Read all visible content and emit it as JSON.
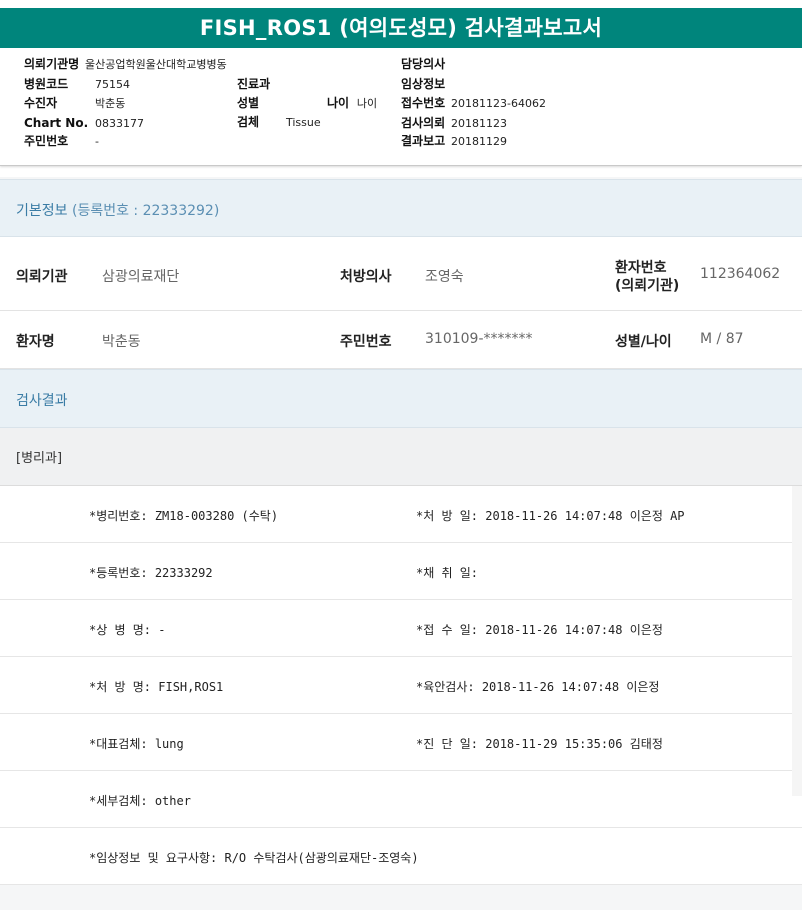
{
  "report": {
    "title": "FISH_ROS1 (여의도성모) 검사결과보고서",
    "fields": {
      "institution_label": "의뢰기관명",
      "institution_value": "울산공업학원울산대학교병병동",
      "hospital_code_label": "병원코드",
      "hospital_code_value": "75154",
      "department_label": "진료과",
      "receiver_label": "수진자",
      "receiver_value": "박춘동",
      "sex_label": "성별",
      "age_label": "나이",
      "age_value": "나이",
      "chart_label": "Chart No.",
      "chart_value": "0833177",
      "specimen_label": "검체",
      "specimen_value": "Tissue",
      "resident_label": "주민번호",
      "resident_value": "-",
      "doctor_label": "담당의사",
      "clinical_label": "임상정보",
      "receipt_label": "접수번호",
      "receipt_value": "20181123-64062",
      "request_label": "검사의뢰",
      "request_value": "20181123",
      "report_label": "결과보고",
      "report_value": "20181129"
    }
  },
  "basic_info": {
    "title": "기본정보",
    "reg_no": "(등록번호 : 22333292)",
    "rows": [
      {
        "c1_label": "의뢰기관",
        "c1_value": "삼광의료재단",
        "c2_label": "처방의사",
        "c2_value": "조영숙",
        "c3_label_1": "환자번호",
        "c3_label_2": "(의뢰기관)",
        "c3_value": "112364062"
      },
      {
        "c1_label": "환자명",
        "c1_value": "박춘동",
        "c2_label": "주민번호",
        "c2_value": "310109-*******",
        "c3_label": "성별/나이",
        "c3_value": "M / 87"
      }
    ]
  },
  "results": {
    "title": "검사결과",
    "dept": "[병리과]",
    "rows": [
      {
        "left": "*병리번호: ZM18-003280 (수탁)",
        "right": "*처 방 일: 2018-11-26 14:07:48  이은정 AP"
      },
      {
        "left": "*등록번호: 22333292",
        "right": "*채 취 일:"
      },
      {
        "left": "*상 병 명: -",
        "right": "*접 수 일: 2018-11-26 14:07:48  이은정"
      },
      {
        "left": "*처 방 명: FISH,ROS1",
        "right": "*육안검사: 2018-11-26 14:07:48  이은정"
      },
      {
        "left": "*대표검체: lung",
        "right": "*진 단 일: 2018-11-29 15:35:06  김태정"
      },
      {
        "left": "*세부검체: other",
        "right": ""
      },
      {
        "left": "*임상정보 및 요구사항: R/O 수탁검사(삼광의료재단-조영숙)",
        "right": ""
      }
    ]
  }
}
